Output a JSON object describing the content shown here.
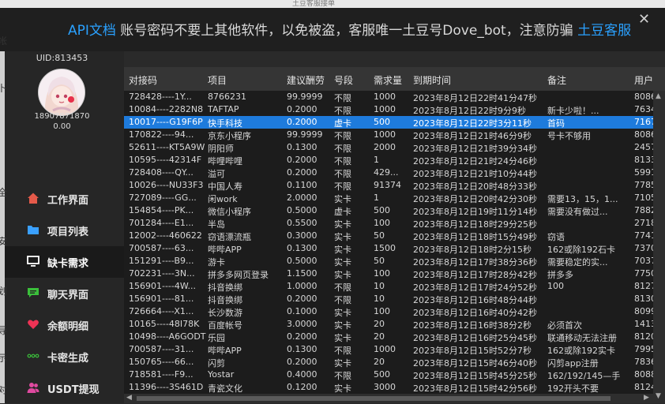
{
  "window": {
    "title": "土豆客服接单"
  },
  "banner": {
    "api": "API文档",
    "notice": " 账号密码不要上其他软件，以免被盗，客服唯一土豆号Dove_bot，注意防骗 ",
    "link": "土豆客服"
  },
  "user": {
    "uid": "UID:813453",
    "phone": "18907871870",
    "balance": "0.00"
  },
  "nav": [
    {
      "label": "工作界面",
      "icon": "home-icon",
      "color": "#e55a4a"
    },
    {
      "label": "项目列表",
      "icon": "folder-icon",
      "color": "#3aa0ff"
    },
    {
      "label": "缺卡需求",
      "icon": "monitor-icon",
      "color": "#ffffff"
    },
    {
      "label": "聊天界面",
      "icon": "chat-icon",
      "color": "#3bbf3b"
    },
    {
      "label": "余额明细",
      "icon": "heart-icon",
      "color": "#ee3355"
    },
    {
      "label": "卡密生成",
      "icon": "dots-icon",
      "color": "#3bbf3b"
    },
    {
      "label": "USDT提现",
      "icon": "users-icon",
      "color": "#e04aa0"
    }
  ],
  "table": {
    "columns": [
      "对接码",
      "项目",
      "建议酬劳",
      "号段",
      "需求量",
      "到期时间",
      "备注",
      "用户"
    ],
    "selected_index": 2,
    "rows": [
      [
        "728428----1Y...",
        "8766231",
        "99.9999",
        "不限",
        "1000",
        "2023年8月12日22时41分47秒",
        "",
        "8086"
      ],
      [
        "10084----2282N8",
        "TAFTAP",
        "0.2000",
        "不限",
        "1000",
        "2023年8月12日22时9分9秒",
        "新卡少啦！...",
        "7634"
      ],
      [
        "10017----G19F6P",
        "快手科技",
        "0.2000",
        "虚卡",
        "500",
        "2023年8月12日22时3分11秒",
        "首码",
        "7167"
      ],
      [
        "170822----94...",
        "京东小程序",
        "99.9999",
        "不限",
        "1000",
        "2023年8月12日21时46分9秒",
        "号卡不够用",
        "8086"
      ],
      [
        "52611----KT5A9W",
        "阴阳师",
        "0.1300",
        "不限",
        "2000",
        "2023年8月12日21时39分34秒",
        "",
        "2457"
      ],
      [
        "10595----42314F",
        "哔哩哔哩",
        "0.2000",
        "不限",
        "1",
        "2023年8月12日21时24分46秒",
        "",
        "8133"
      ],
      [
        "728408----QY...",
        "溢可",
        "0.2000",
        "不限",
        "429...",
        "2023年8月12日21时10分44秒",
        "",
        "5991"
      ],
      [
        "10026----NU33F3",
        "中国人寿",
        "0.1100",
        "不限",
        "91374",
        "2023年8月12日20时48分33秒",
        "",
        "7785"
      ],
      [
        "727089----GG...",
        "闲work",
        "2.0000",
        "实卡",
        "1",
        "2023年8月12日20时42分30秒",
        "需要13，15，1...",
        "7105"
      ],
      [
        "154854----PK...",
        "微信小程序",
        "0.5000",
        "虚卡",
        "500",
        "2023年8月12日19时11分14秒",
        "需要没有做过...",
        "7882"
      ],
      [
        "701284----E1...",
        "半岛",
        "0.5500",
        "实卡",
        "100",
        "2023年8月12日18时29分25秒",
        "",
        "2718"
      ],
      [
        "12002----460622",
        "窃语漂流瓶",
        "0.3000",
        "实卡",
        "50",
        "2023年8月12日18时15分49秒",
        "窃语",
        "7741"
      ],
      [
        "700587----63...",
        "哔哔APP",
        "0.1300",
        "实卡",
        "1500",
        "2023年8月12日18时2分15秒",
        "162或除192石卡",
        "7370"
      ],
      [
        "151291----B9...",
        "游卡",
        "0.5000",
        "实卡",
        "50",
        "2023年8月12日17时38分36秒",
        "需要稳定的实...",
        "7037"
      ],
      [
        "702231----3N...",
        "拼多多网页登录",
        "1.1500",
        "实卡",
        "100",
        "2023年8月12日17时28分42秒",
        "拼多多",
        "7750"
      ],
      [
        "156901----4W...",
        "抖音换绑",
        "1.0000",
        "不限",
        "10",
        "2023年8月12日17时24分52秒",
        "100",
        "8127"
      ],
      [
        "156901----81...",
        "抖音换绑",
        "0.2000",
        "不限",
        "10",
        "2023年8月12日16时48分44秒",
        "",
        "8130"
      ],
      [
        "726664----X1...",
        "长沙数游",
        "0.1000",
        "实卡",
        "100",
        "2023年8月12日16时40分42秒",
        "",
        "8099"
      ],
      [
        "10165----48I78K",
        "百度帐号",
        "3.0000",
        "实卡",
        "20",
        "2023年8月12日16时38分2秒",
        "必须首次",
        "1413"
      ],
      [
        "10498----A6GODT",
        "乐园",
        "0.2000",
        "实卡",
        "20",
        "2023年8月12日16时25分45秒",
        "联通移动无法注册",
        "8120"
      ],
      [
        "700587----31...",
        "哔哔APP",
        "0.1300",
        "不限",
        "1000",
        "2023年8月12日15时52分7秒",
        "162或除192实卡",
        "7995"
      ],
      [
        "150765----66...",
        "闪剪",
        "0.2000",
        "实卡",
        "20",
        "2023年8月12日15时46分40秒",
        "闪剪app注册",
        "7836"
      ],
      [
        "718581----F9...",
        "Yostar",
        "0.4000",
        "不限",
        "500",
        "2023年8月12日15时45分25秒",
        "162/192/145—手",
        "8088"
      ],
      [
        "11396----3S461D",
        "青瓷文化",
        "0.1200",
        "实卡",
        "3000",
        "2023年8月12日15时42分56秒",
        "192开头不要",
        "8124"
      ]
    ]
  },
  "edge_chars": [
    "帐",
    "卜",
    "全",
    "安",
    "划",
    "导",
    "示",
    "对"
  ]
}
